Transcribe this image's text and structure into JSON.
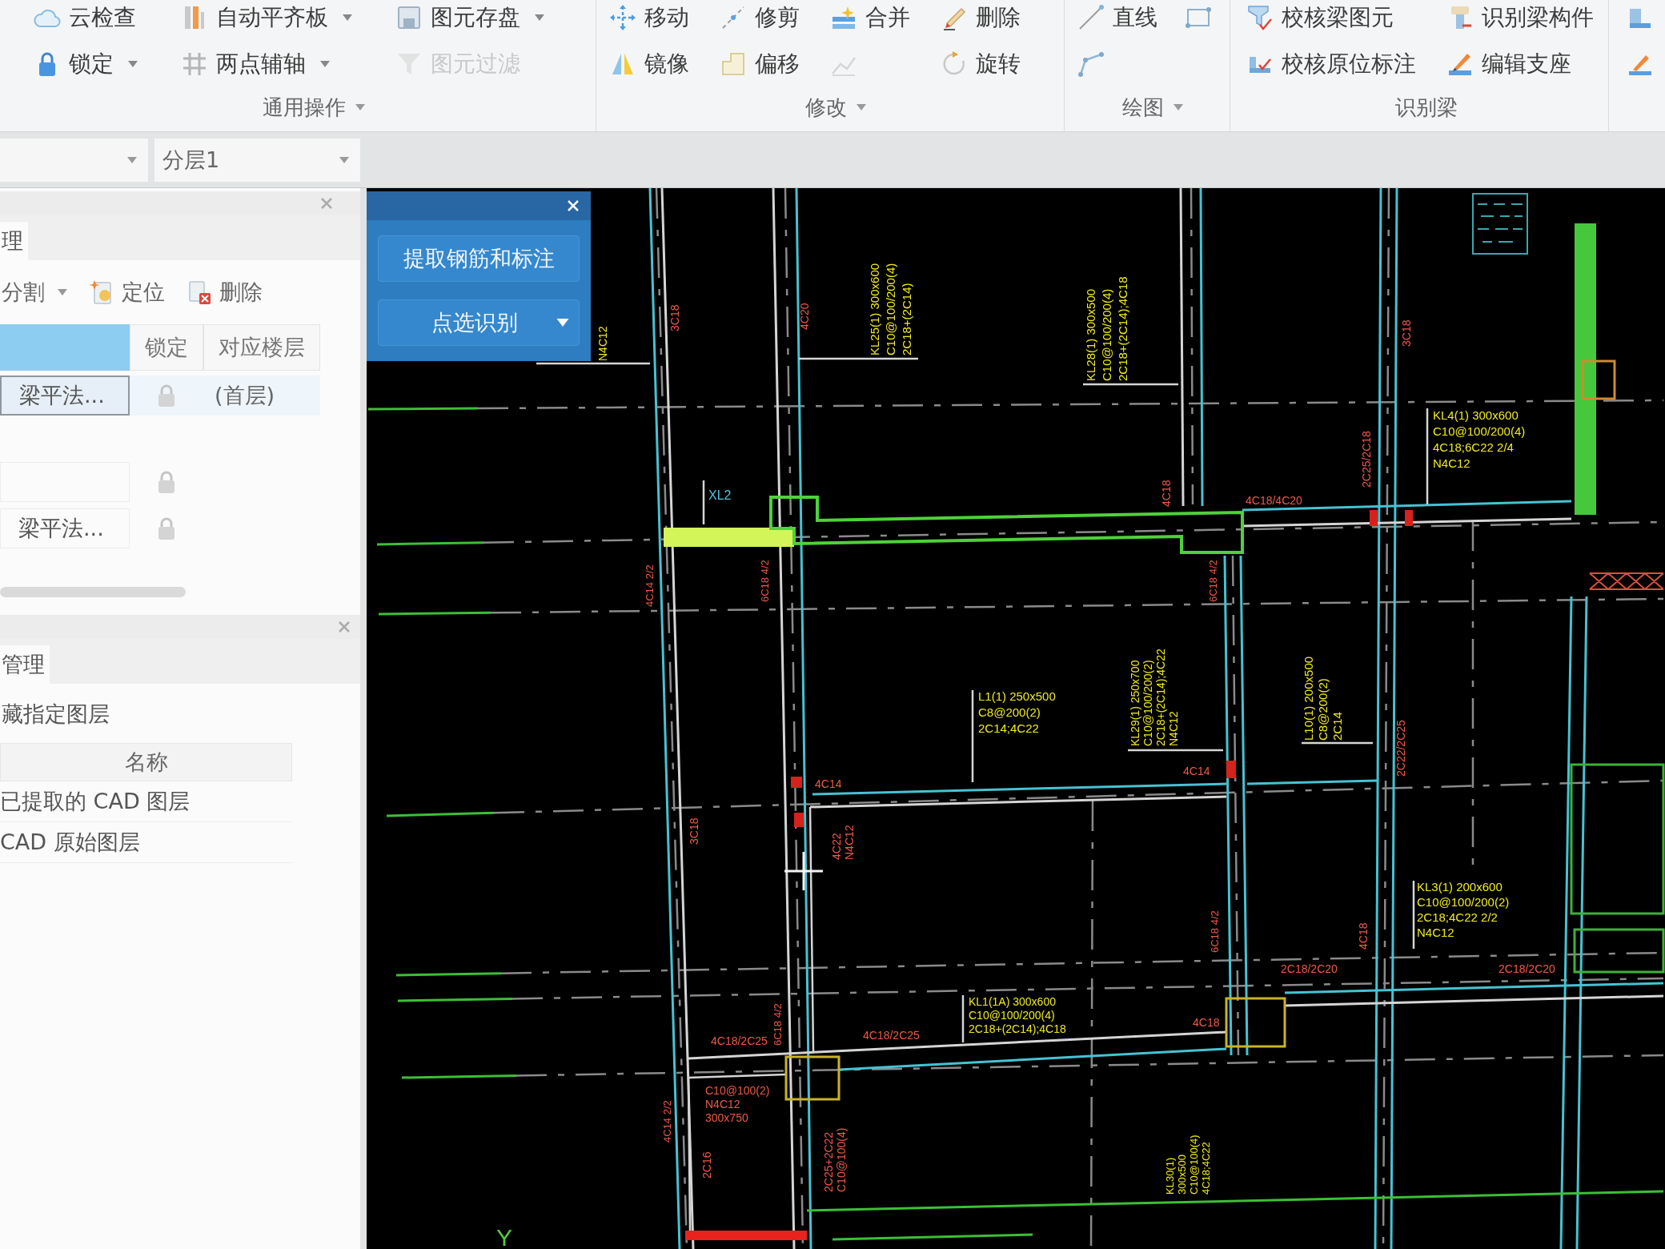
{
  "ribbon": {
    "groups": [
      {
        "label": "通用操作",
        "dropdown": true,
        "items": [
          {
            "label": "云检查",
            "dropdown": false,
            "disabled": false
          },
          {
            "label": "锁定",
            "dropdown": true,
            "disabled": false
          },
          {
            "label": "自动平齐板",
            "dropdown": true,
            "disabled": false
          },
          {
            "label": "两点辅轴",
            "dropdown": true,
            "disabled": false
          },
          {
            "label": "图元存盘",
            "dropdown": true,
            "disabled": false
          },
          {
            "label": "图元过滤",
            "dropdown": false,
            "disabled": true
          }
        ]
      },
      {
        "label": "修改",
        "dropdown": true,
        "items": [
          {
            "label": "移动",
            "dropdown": false,
            "disabled": false
          },
          {
            "label": "镜像",
            "dropdown": false,
            "disabled": false
          },
          {
            "label": "修剪",
            "dropdown": false,
            "disabled": false
          },
          {
            "label": "偏移",
            "dropdown": false,
            "disabled": false
          },
          {
            "label": "合并",
            "dropdown": false,
            "disabled": false
          },
          {
            "dropdown": false,
            "disabled": true
          },
          {
            "label": "删除",
            "dropdown": false,
            "disabled": false
          },
          {
            "label": "旋转",
            "dropdown": false,
            "disabled": false
          }
        ]
      },
      {
        "label": "绘图",
        "dropdown": true,
        "items": [
          {
            "label": "直线",
            "dropdown": false,
            "disabled": false
          },
          {
            "dropdown": false,
            "disabled": false
          },
          {
            "dropdown": false,
            "disabled": false
          }
        ]
      },
      {
        "label": "识别梁",
        "dropdown": false,
        "items": [
          {
            "label": "校核梁图元",
            "dropdown": false,
            "disabled": false
          },
          {
            "label": "校核原位标注",
            "dropdown": false,
            "disabled": false
          },
          {
            "label": "识别梁构件",
            "dropdown": false,
            "disabled": false
          },
          {
            "label": "编辑支座",
            "dropdown": false,
            "disabled": false
          }
        ]
      },
      {
        "items": [
          {
            "dropdown": false,
            "disabled": false
          },
          {
            "dropdown": false,
            "disabled": false
          }
        ]
      }
    ]
  },
  "toolbar": {
    "layer_selector": {
      "value": "分层1"
    }
  },
  "layer_panel": {
    "tabs": [
      {
        "label": "理",
        "selected": true
      }
    ],
    "toolbar": [
      {
        "label": "分割",
        "dropdown": true
      },
      {
        "label": "定位",
        "dropdown": false
      },
      {
        "label": "删除",
        "dropdown": false
      }
    ],
    "columns": [
      {
        "selected": true
      },
      {
        "label": "锁定",
        "selected": false
      },
      {
        "label": "对应楼层",
        "selected": false
      }
    ],
    "rows": [
      {
        "name": "梁平法...",
        "locked": true,
        "floor": "(首层)",
        "selected": true
      },
      {
        "locked": true,
        "selected": false
      },
      {
        "name": "梁平法...",
        "locked": true,
        "selected": false
      }
    ]
  },
  "cad_layer_panel": {
    "tabs": [
      {
        "label": "管理",
        "selected": true
      }
    ],
    "action": "藏指定图层",
    "columns": [
      {
        "label": "名称"
      }
    ],
    "rows": [
      {
        "name": "已提取的 CAD 图层"
      },
      {
        "name": "CAD 原始图层"
      }
    ]
  },
  "dialog": {
    "buttons": [
      {
        "label": "提取钢筋和标注",
        "dropdown": false
      },
      {
        "label": "点选识别",
        "dropdown": true
      }
    ]
  },
  "drawing": {
    "axis_label": "Y",
    "annotations": [
      {
        "lines": [
          "N4C12"
        ],
        "color": "#eeea1e"
      },
      {
        "lines": [
          "3C18"
        ],
        "color": "#ee5a48"
      },
      {
        "lines": [
          "4C20"
        ],
        "color": "#ee5a48"
      },
      {
        "lines": [
          "KL25(1) 300x600",
          "C10@100/200(4)",
          "2C18+(2C14)"
        ],
        "color": "#eeea1e"
      },
      {
        "lines": [
          "KL28(1) 300x500",
          "C10@100/200(4)",
          "2C18+(2C14);4C18"
        ],
        "color": "#eeea1e"
      },
      {
        "lines": [
          "XL2"
        ],
        "color": "#4cc3e0"
      },
      {
        "lines": [
          "4C14 2/2"
        ],
        "color": "#ee5a48"
      },
      {
        "lines": [
          "6C18 4/2"
        ],
        "color": "#ee5a48"
      },
      {
        "lines": [
          "4C18"
        ],
        "color": "#ee5a48"
      },
      {
        "lines": [
          "4C18/4C20"
        ],
        "color": "#ee5a48"
      },
      {
        "lines": [
          "2C25/2C18"
        ],
        "color": "#ee5a48"
      },
      {
        "lines": [
          "3C18"
        ],
        "color": "#ee5a48"
      },
      {
        "lines": [
          "KL4(1) 300x600",
          "C10@100/200(4)",
          "4C18;6C22 2/4",
          "N4C12"
        ],
        "color": "#eeea1e"
      },
      {
        "lines": [
          "6C18 4/2"
        ],
        "color": "#ee5a48"
      },
      {
        "lines": [
          "L1(1) 250x500",
          "C8@200(2)",
          "2C14;4C22"
        ],
        "color": "#eeea1e"
      },
      {
        "lines": [
          "KL29(1) 250x700",
          "C10@100/200(2)",
          "2C18+(2C14);4C22",
          "N4C12"
        ],
        "color": "#eeea1e"
      },
      {
        "lines": [
          "4C14"
        ],
        "color": "#ee5a48"
      },
      {
        "lines": [
          "4C14"
        ],
        "color": "#ee5a48"
      },
      {
        "lines": [
          "L10(1) 200x500",
          "C8@200(2)",
          "2C14"
        ],
        "color": "#eeea1e"
      },
      {
        "lines": [
          "2C22/2C25"
        ],
        "color": "#ee5a48"
      },
      {
        "lines": [
          "3C18"
        ],
        "color": "#ee5a48"
      },
      {
        "lines": [
          "4C22",
          "N4C12"
        ],
        "color": "#ee5a48"
      },
      {
        "lines": [
          "KL1(1A) 300x600",
          "C10@100/200(4)",
          "2C18+(2C14);4C18"
        ],
        "color": "#eeea1e"
      },
      {
        "lines": [
          "6C18 4/2"
        ],
        "color": "#ee5a48"
      },
      {
        "lines": [
          "6C18 4/2"
        ],
        "color": "#ee5a48"
      },
      {
        "lines": [
          "4C18/2C25"
        ],
        "color": "#ee5a48"
      },
      {
        "lines": [
          "4C18/2C25"
        ],
        "color": "#ee5a48"
      },
      {
        "lines": [
          "4C18"
        ],
        "color": "#ee5a48"
      },
      {
        "lines": [
          "2C18/2C20"
        ],
        "color": "#ee5a48"
      },
      {
        "lines": [
          "C10@100(2)",
          "N4C12",
          "300x750"
        ],
        "color": "#ee5a48"
      },
      {
        "lines": [
          "4C14 2/2"
        ],
        "color": "#ee5a48"
      },
      {
        "lines": [
          "2C16"
        ],
        "color": "#ee5a48"
      },
      {
        "lines": [
          "2C25+2C22",
          "C10@100(4)"
        ],
        "color": "#ee5a48"
      },
      {
        "lines": [
          "KL30(1)",
          "300x500",
          "C10@100(4)",
          "4C18;4C22"
        ],
        "color": "#eeea1e"
      },
      {
        "lines": [
          "KL3(1) 200x600",
          "C10@100/200(2)",
          "2C18;4C22 2/2",
          "N4C12"
        ],
        "color": "#eeea1e"
      },
      {
        "lines": [
          "4C18"
        ],
        "color": "#ee5a48"
      },
      {
        "lines": [
          "2C18/2C20"
        ],
        "color": "#ee5a48"
      }
    ]
  }
}
